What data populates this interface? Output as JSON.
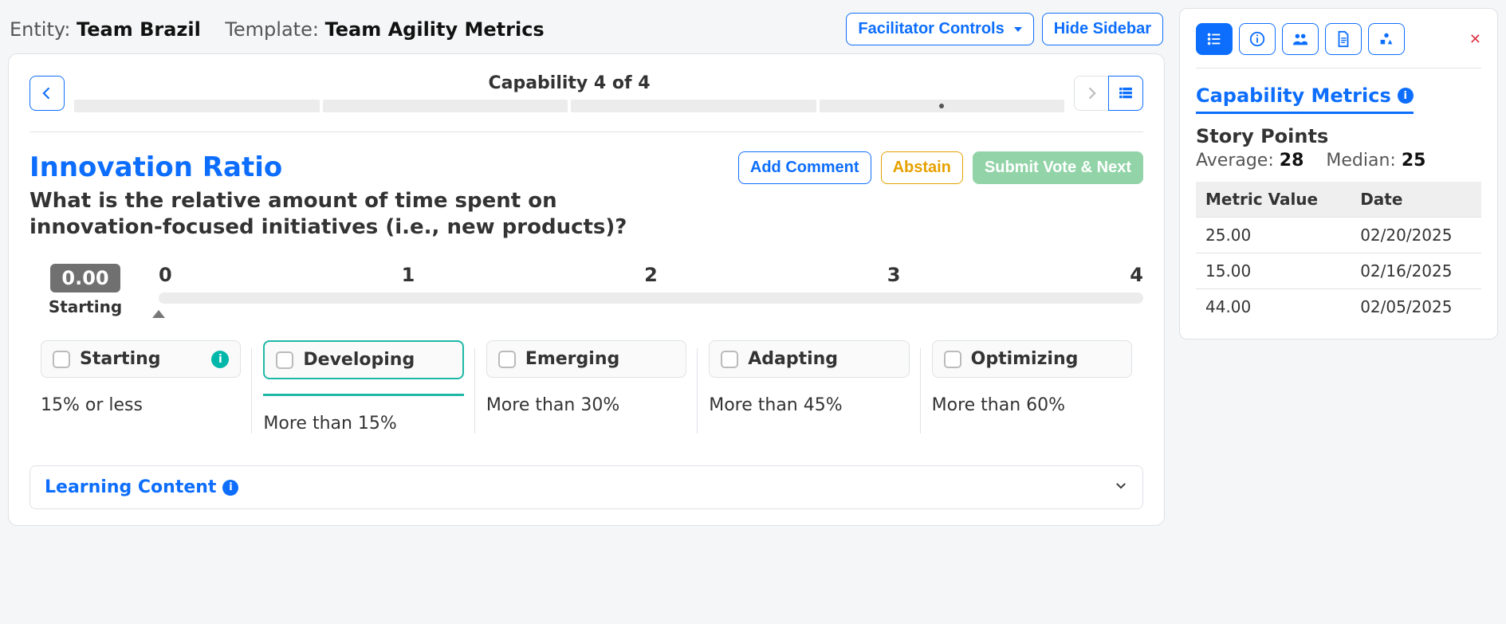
{
  "header": {
    "entity_label": "Entity:",
    "entity_value": "Team Brazil",
    "template_label": "Template:",
    "template_value": "Team Agility Metrics",
    "facilitator_btn": "Facilitator Controls",
    "hide_sidebar_btn": "Hide Sidebar"
  },
  "nav": {
    "progress_title": "Capability 4 of 4",
    "current_index": 3,
    "total": 4
  },
  "capability": {
    "title": "Innovation Ratio",
    "description": "What is the relative amount of time spent on innovation-focused initiatives (i.e., new products)?",
    "add_comment": "Add Comment",
    "abstain": "Abstain",
    "submit": "Submit Vote & Next"
  },
  "slider": {
    "current_value": "0.00",
    "current_label": "Starting",
    "ticks": [
      "0",
      "1",
      "2",
      "3",
      "4"
    ]
  },
  "levels": [
    {
      "name": "Starting",
      "desc": "15% or less",
      "starting": true,
      "selected": false
    },
    {
      "name": "Developing",
      "desc": "More than 15%",
      "starting": false,
      "selected": true
    },
    {
      "name": "Emerging",
      "desc": "More than 30%",
      "starting": false,
      "selected": false
    },
    {
      "name": "Adapting",
      "desc": "More than 45%",
      "starting": false,
      "selected": false
    },
    {
      "name": "Optimizing",
      "desc": "More than 60%",
      "starting": false,
      "selected": false
    }
  ],
  "learning": {
    "title": "Learning Content"
  },
  "sidebar": {
    "title": "Capability Metrics",
    "metric_name": "Story Points",
    "avg_label": "Average:",
    "avg_value": "28",
    "med_label": "Median:",
    "med_value": "25",
    "headers": {
      "value": "Metric Value",
      "date": "Date"
    },
    "rows": [
      {
        "value": "25.00",
        "date": "02/20/2025"
      },
      {
        "value": "15.00",
        "date": "02/16/2025"
      },
      {
        "value": "44.00",
        "date": "02/05/2025"
      }
    ]
  }
}
